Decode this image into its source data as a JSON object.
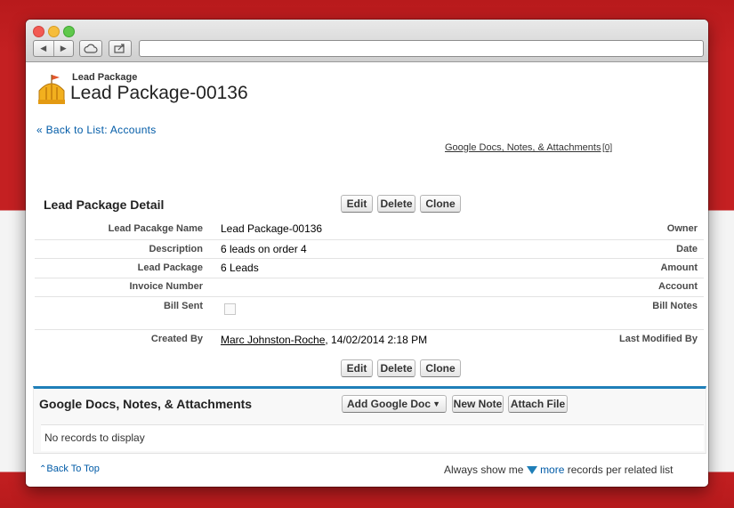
{
  "colors": {
    "accent_blue": "#1f7fb8",
    "link_blue": "#015ba7",
    "background_red": "#c42022"
  },
  "browser": {
    "back_icon": "chevron-left-icon",
    "forward_icon": "chevron-right-icon",
    "cloud_icon": "icloud-icon",
    "share_icon": "share-icon",
    "url_value": ""
  },
  "header": {
    "record_type": "Lead Package",
    "title": "Lead Package-00136",
    "icon": "lead-package-icon"
  },
  "back_link": "« Back to List: Accounts",
  "related_links": {
    "label": "Google Docs, Notes, & Attachments",
    "count": "[0]"
  },
  "detail": {
    "section_title": "Lead Package Detail",
    "buttons": {
      "edit": "Edit",
      "delete": "Delete",
      "clone": "Clone"
    },
    "fields": {
      "name_label": "Lead Pacakge Name",
      "name_value": "Lead Package-00136",
      "description_label": "Description",
      "description_value": "6 leads on order 4",
      "package_label": "Lead Package",
      "package_value": "6 Leads",
      "invoice_label": "Invoice Number",
      "invoice_value": "",
      "bill_sent_label": "Bill Sent",
      "created_by_label": "Created By",
      "created_by_name": "Marc Johnston-Roche",
      "created_by_date": ", 14/02/2014 2:18 PM"
    },
    "right_labels": {
      "owner": "Owner",
      "date": "Date",
      "amount": "Amount",
      "account": "Account",
      "bill_notes": "Bill Notes",
      "last_modified_by": "Last Modified By"
    }
  },
  "related_list": {
    "title": "Google Docs, Notes, & Attachments",
    "add_google_doc": "Add Google Doc",
    "new_note": "New Note",
    "attach_file": "Attach File",
    "empty_text": "No records to display"
  },
  "footer": {
    "back_to_top": "Back To Top",
    "always_show": "Always show me",
    "more": "more",
    "records_suffix": "records per related list"
  }
}
